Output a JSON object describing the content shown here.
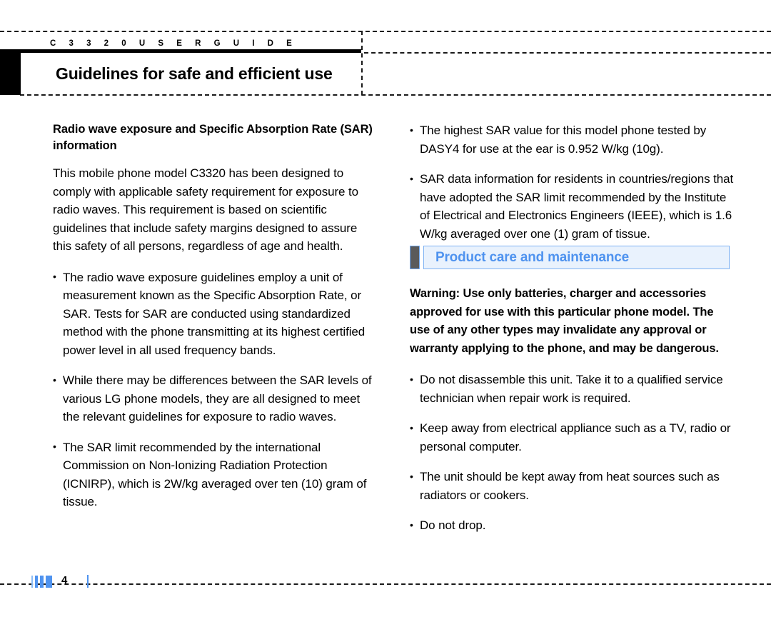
{
  "document": {
    "kicker": "C 3 3 2 0   U S E R   G U I D E",
    "chapter_title": "Guidelines for safe and efficient use",
    "page_number": "4"
  },
  "colors": {
    "accent_blue": "#4f93ef",
    "accent_blue_light": "#e9f2fd",
    "accent_blue_border": "#7eb2f3",
    "mark_gray": "#5a5a5a",
    "text": "#000000"
  },
  "left_column": {
    "subheading": "Radio wave exposure and Specific Absorption Rate (SAR) information",
    "intro_paragraph": "This mobile phone model C3320 has been designed to comply with applicable safety requirement for exposure to radio waves. This requirement is based on scientific guidelines that include safety margins designed to assure this safety of all persons, regardless of age and health.",
    "bullets": [
      "The radio wave exposure guidelines employ a unit of measurement known as the Specific Absorption Rate, or SAR. Tests for SAR are conducted using standardized method with the phone transmitting at its highest certified power level in all used frequency bands.",
      "While there may be differences between the SAR levels of various LG phone models, they are all designed to meet the relevant guidelines for exposure to radio waves.",
      "The SAR limit recommended by the international Commission on Non-Ionizing Radiation Protection (ICNIRP), which is 2W/kg averaged over ten (10) gram of tissue."
    ]
  },
  "right_column": {
    "top_bullets": [
      "The highest SAR value for this model phone tested by DASY4 for use at the ear is 0.952 W/kg (10g).",
      "SAR data information for residents in countries/regions that have adopted the SAR limit recommended by the Institute of Electrical and Electronics Engineers (IEEE), which is 1.6 W/kg averaged over one (1) gram of tissue."
    ],
    "section_heading": "Product care and maintenance",
    "warning": "Warning: Use only batteries, charger and accessories approved for use with this particular phone model. The use of any other types may invalidate any approval or warranty applying to the phone, and may be dangerous.",
    "care_bullets": [
      "Do not disassemble this unit. Take it to a qualified service technician when repair work is required.",
      "Keep away from electrical appliance such as a TV, radio or personal computer.",
      "The unit should be kept away from heat sources such as radiators or cookers.",
      "Do not drop."
    ]
  }
}
